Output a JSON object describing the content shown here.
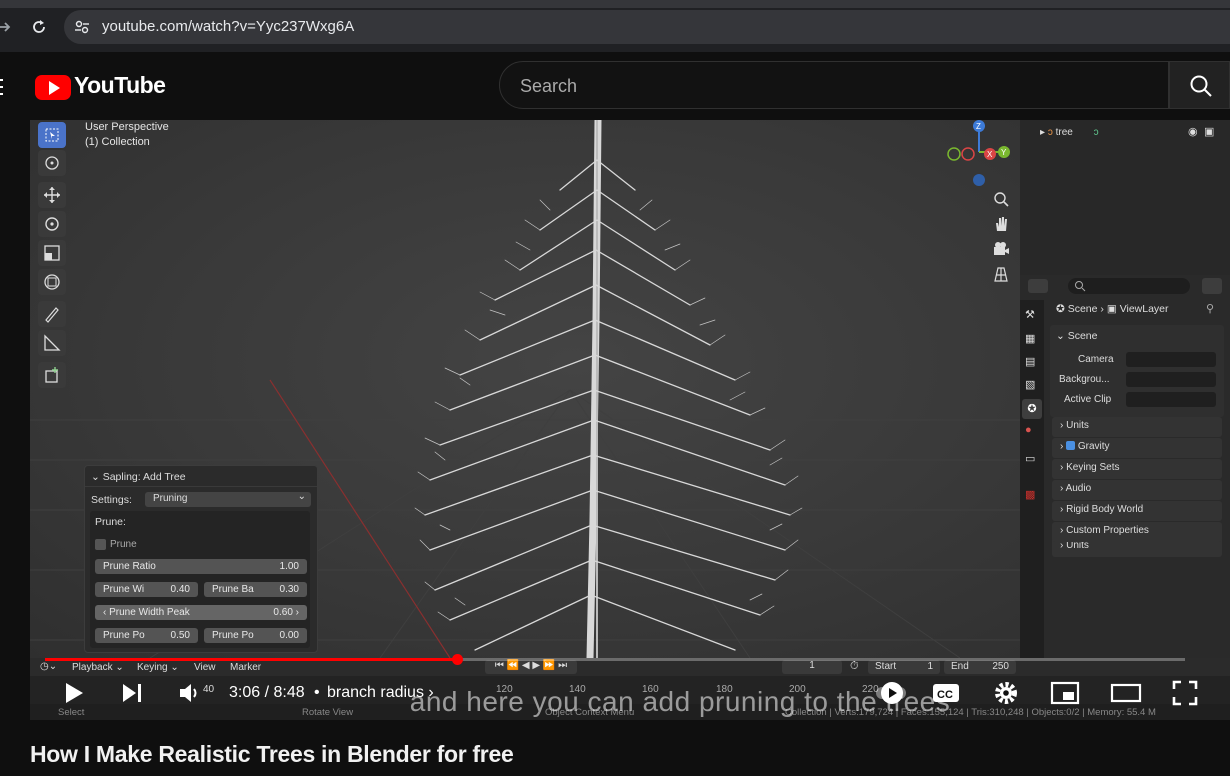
{
  "browser": {
    "url": "youtube.com/watch?v=Yyc237Wxg6A"
  },
  "header": {
    "logo_text": "YouTube",
    "search_placeholder": "Search"
  },
  "video": {
    "viewport_mode": "User Perspective",
    "collection": "(1) Collection",
    "outliner_item": "tree",
    "sapling": {
      "title": "Sapling: Add Tree",
      "settings_label": "Settings:",
      "settings_value": "Pruning",
      "section": "Prune:",
      "prune_checkbox": "Prune",
      "prune_ratio_label": "Prune Ratio",
      "prune_ratio_value": "1.00",
      "prune_width_label": "Prune Wi",
      "prune_width_value": "0.40",
      "prune_base_label": "Prune Ba",
      "prune_base_value": "0.30",
      "prune_width_peak_label": "Prune Width Peak",
      "prune_width_peak_value": "0.60",
      "prune_power_low_label": "Prune Po",
      "prune_power_low_value": "0.50",
      "prune_power_high_label": "Prune Po",
      "prune_power_high_value": "0.00"
    },
    "properties": {
      "breadcrumb_scene": "Scene",
      "breadcrumb_viewlayer": "ViewLayer",
      "panel_scene": "Scene",
      "camera_label": "Camera",
      "background_label": "Backgrou...",
      "active_clip_label": "Active Clip",
      "units": "Units",
      "gravity": "Gravity",
      "keying_sets": "Keying Sets",
      "audio": "Audio",
      "rigid_body_world": "Rigid Body World",
      "custom_properties": "Custom Properties"
    },
    "timeline": {
      "playback": "Playback",
      "keying": "Keying",
      "view": "View",
      "marker": "Marker",
      "current_frame": "1",
      "start_label": "Start",
      "start_value": "1",
      "end_label": "End",
      "end_value": "250",
      "ticks": [
        "120",
        "140",
        "160",
        "180",
        "200",
        "220"
      ]
    },
    "status_bar": {
      "select": "Select",
      "rotate_view": "Rotate View",
      "context_menu": "Object Context Menu",
      "stats": "Collection | Verts:179,724 | Faces:155,124 | Tris:310,248 | Objects:0/2 | Memory: 55.4 M"
    },
    "caption": "and here you can add pruning to the trees"
  },
  "player": {
    "progress": 0.361,
    "volume_number": "40",
    "time": "3:06 / 8:48",
    "chapter": "branch radius",
    "chapter_sep": "•"
  },
  "page": {
    "title": "How I Make Realistic Trees in Blender for free"
  }
}
